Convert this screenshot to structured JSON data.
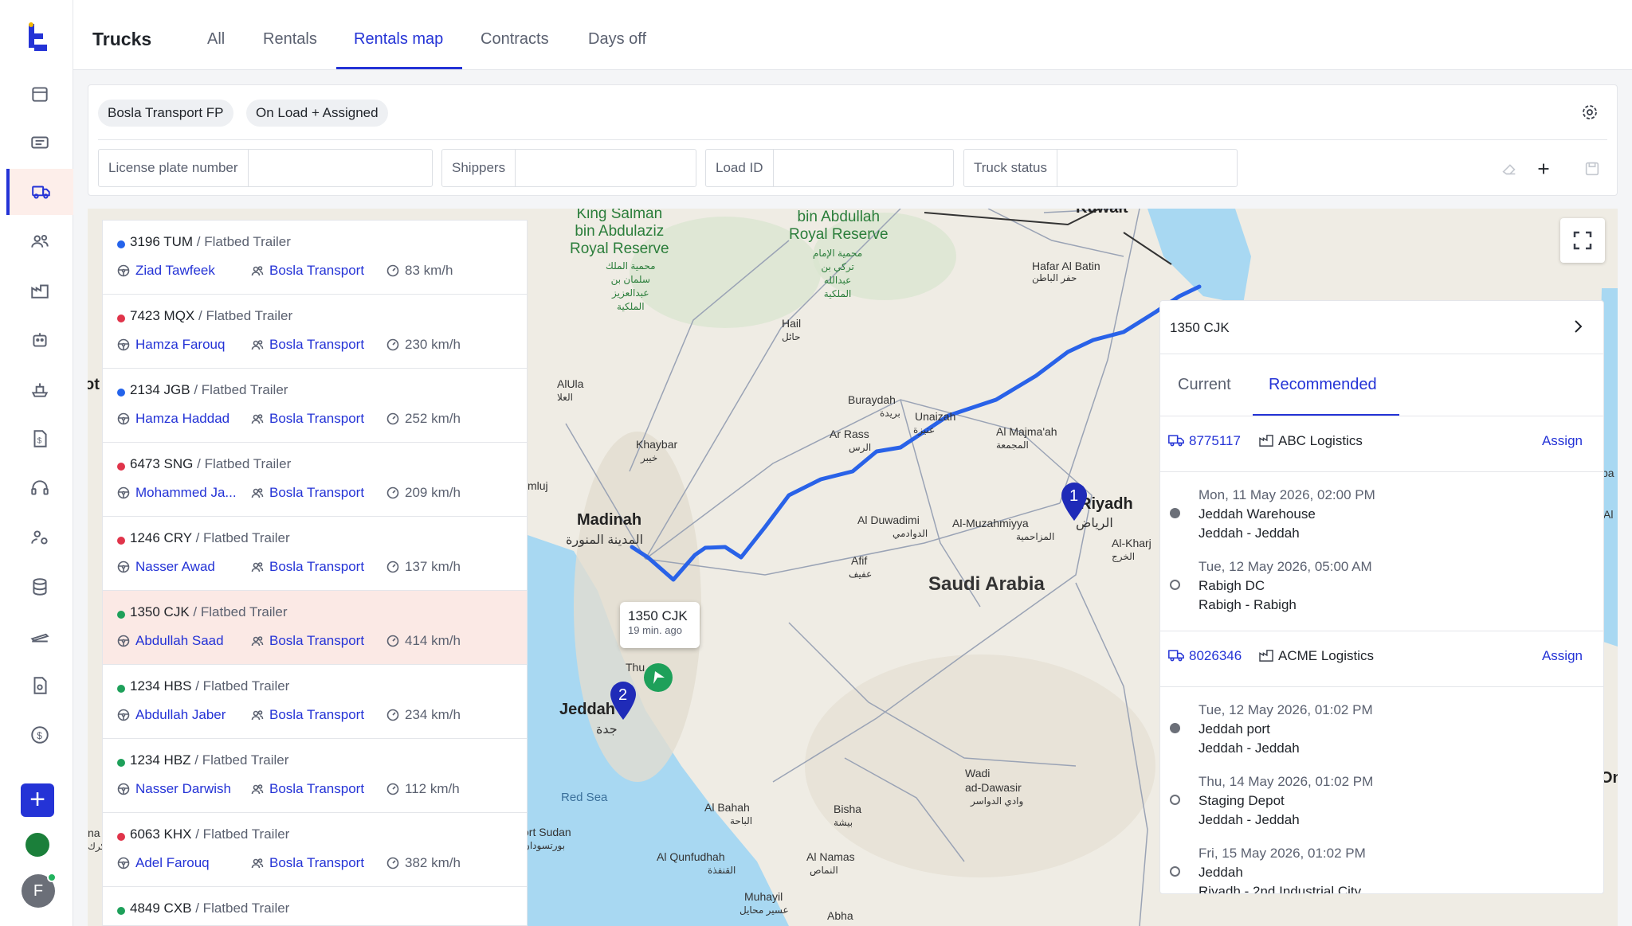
{
  "header": {
    "title": "Trucks",
    "tabs": [
      "All",
      "Rentals",
      "Rentals map",
      "Contracts",
      "Days off"
    ],
    "active_tab": "Rentals map"
  },
  "filters": {
    "chips": [
      "Bosla Transport FP",
      "On Load + Assigned"
    ],
    "fields": [
      {
        "label": "License plate number",
        "value": ""
      },
      {
        "label": "Shippers",
        "value": ""
      },
      {
        "label": "Load ID",
        "value": ""
      },
      {
        "label": "Truck status",
        "value": ""
      }
    ]
  },
  "trucks": [
    {
      "plate": "3196 TUM",
      "type": "/ Flatbed Trailer",
      "driver": "Ziad Tawfeek",
      "company": "Bosla Transport",
      "speed": "83 km/h",
      "status_color": "#2463eb"
    },
    {
      "plate": "7423 MQX",
      "type": "/ Flatbed Trailer",
      "driver": "Hamza Farouq",
      "company": "Bosla Transport",
      "speed": "230 km/h",
      "status_color": "#e0344a"
    },
    {
      "plate": "2134 JGB",
      "type": "/ Flatbed Trailer",
      "driver": "Hamza Haddad",
      "company": "Bosla Transport",
      "speed": "252 km/h",
      "status_color": "#2463eb"
    },
    {
      "plate": "6473 SNG",
      "type": "/ Flatbed Trailer",
      "driver": "Mohammed Ja...",
      "company": "Bosla Transport",
      "speed": "209 km/h",
      "status_color": "#e0344a"
    },
    {
      "plate": "1246 CRY",
      "type": "/ Flatbed Trailer",
      "driver": "Nasser Awad",
      "company": "Bosla Transport",
      "speed": "137 km/h",
      "status_color": "#e0344a"
    },
    {
      "plate": "1350 CJK",
      "type": "/ Flatbed Trailer",
      "driver": "Abdullah Saad",
      "company": "Bosla Transport",
      "speed": "414 km/h",
      "status_color": "#1ea05a",
      "selected": true
    },
    {
      "plate": "1234 HBS",
      "type": "/ Flatbed Trailer",
      "driver": "Abdullah Jaber",
      "company": "Bosla Transport",
      "speed": "234 km/h",
      "status_color": "#1ea05a"
    },
    {
      "plate": "1234 HBZ",
      "type": "/ Flatbed Trailer",
      "driver": "Nasser Darwish",
      "company": "Bosla Transport",
      "speed": "112 km/h",
      "status_color": "#1ea05a"
    },
    {
      "plate": "6063 KHX",
      "type": "/ Flatbed Trailer",
      "driver": "Adel Farouq",
      "company": "Bosla Transport",
      "speed": "382 km/h",
      "status_color": "#e0344a"
    },
    {
      "plate": "4849 CXB",
      "type": "/ Flatbed Trailer",
      "driver": "",
      "company": "",
      "speed": "",
      "status_color": "#1ea05a"
    }
  ],
  "map": {
    "popup": {
      "plate": "1350 CJK",
      "time": "19 min. ago"
    },
    "markers": [
      "1",
      "2"
    ],
    "labels": {
      "kuwait": "Kuwait",
      "king_salman": "King Salman\nbin Abdulaziz\nRoyal Reserve",
      "king_salman_ar": "محمية الملك\nسلمان بن\nعبدالعزيز\nالملكية",
      "bin_abdullah": "bin Abdullah\nRoyal Reserve",
      "bin_abdullah_ar": "محمية الإمام\nتركي بن\nعبدالله\nالملكية",
      "hafar": "Hafar Al Batin",
      "hafar_ar": "حفر الباطن",
      "hail": "Hail",
      "hail_ar": "حائل",
      "alula": "AlUla",
      "alula_ar": "العلا",
      "buraydah": "Buraydah",
      "buraydah_ar": "بريدة",
      "unaizah": "Unaizah",
      "unaizah_ar": "عنيزة",
      "arrass": "Ar Rass",
      "arrass_ar": "الرس",
      "majmaah": "Al Majma'ah",
      "majmaah_ar": "المجمعة",
      "khaybar": "Khaybar",
      "khaybar_ar": "خيبر",
      "umluj": "mluj",
      "madinah": "Madinah",
      "madinah_ar": "المدينة المنورة",
      "riyadh": "Riyadh",
      "riyadh_ar": "الرياض",
      "duwadimi": "Al Duwadimi",
      "duwadimi_ar": "الدوادمي",
      "muzahmiyya": "Al-Muzahmiyya",
      "muzahmiyya_ar": "المزاحمية",
      "kharj": "Al-Kharj",
      "kharj_ar": "الخرج",
      "afif": "Afif",
      "afif_ar": "عفيف",
      "saudi": "Saudi Arabia",
      "jeddah": "Jeddah",
      "jeddah_ar": "جدة",
      "thuwal": "Thu",
      "wadi": "Wadi\nad-Dawasir",
      "wadi_ar": "وادي الدواسر",
      "red_sea": "Red Sea",
      "albahah": "Al Bahah",
      "albahah_ar": "الباحة",
      "bisha": "Bisha",
      "bisha_ar": "بيشة",
      "port_sudan": "ort Sudan",
      "port_sudan_ar": "بورتسودان",
      "qunfudhah": "Al Qunfudhah",
      "qunfudhah_ar": "القنفذة",
      "namas": "Al Namas",
      "namas_ar": "النماص",
      "muhayil": "Muhayil",
      "muhayil_ar": "عسير محايل",
      "abha": "Abha",
      "egypt_tail": "ot",
      "left_na": "na",
      "left_ar": "کرك",
      "right_ba": "ba",
      "right_al": "Al",
      "right_on": "On"
    }
  },
  "panel": {
    "title": "1350 CJK",
    "tabs": [
      "Current",
      "Recommended"
    ],
    "active_tab": "Recommended",
    "loads": [
      {
        "id": "8775117",
        "company": "ABC Logistics",
        "action": "Assign",
        "stops": [
          {
            "date": "Mon, 11 May 2026, 02:00 PM",
            "name": "Jeddah Warehouse",
            "route": "Jeddah - Jeddah",
            "done": true
          },
          {
            "date": "Tue, 12 May 2026, 05:00 AM",
            "name": "Rabigh DC",
            "route": "Rabigh - Rabigh",
            "done": false
          }
        ]
      },
      {
        "id": "8026346",
        "company": "ACME Logistics",
        "action": "Assign",
        "stops": [
          {
            "date": "Tue, 12 May 2026, 01:02 PM",
            "name": "Jeddah port",
            "route": "Jeddah - Jeddah",
            "done": true
          },
          {
            "date": "Thu, 14 May 2026, 01:02 PM",
            "name": "Staging Depot",
            "route": "Jeddah - Jeddah",
            "done": false
          },
          {
            "date": "Fri, 15 May 2026, 01:02 PM",
            "name": "Jeddah",
            "route": "Riyadh - 2nd Industrial City",
            "done": false
          }
        ]
      }
    ]
  },
  "user": {
    "initial": "F"
  },
  "colors": {
    "accent": "#2433d6",
    "route": "#2962e8",
    "selected_row": "#fbe9e5"
  }
}
